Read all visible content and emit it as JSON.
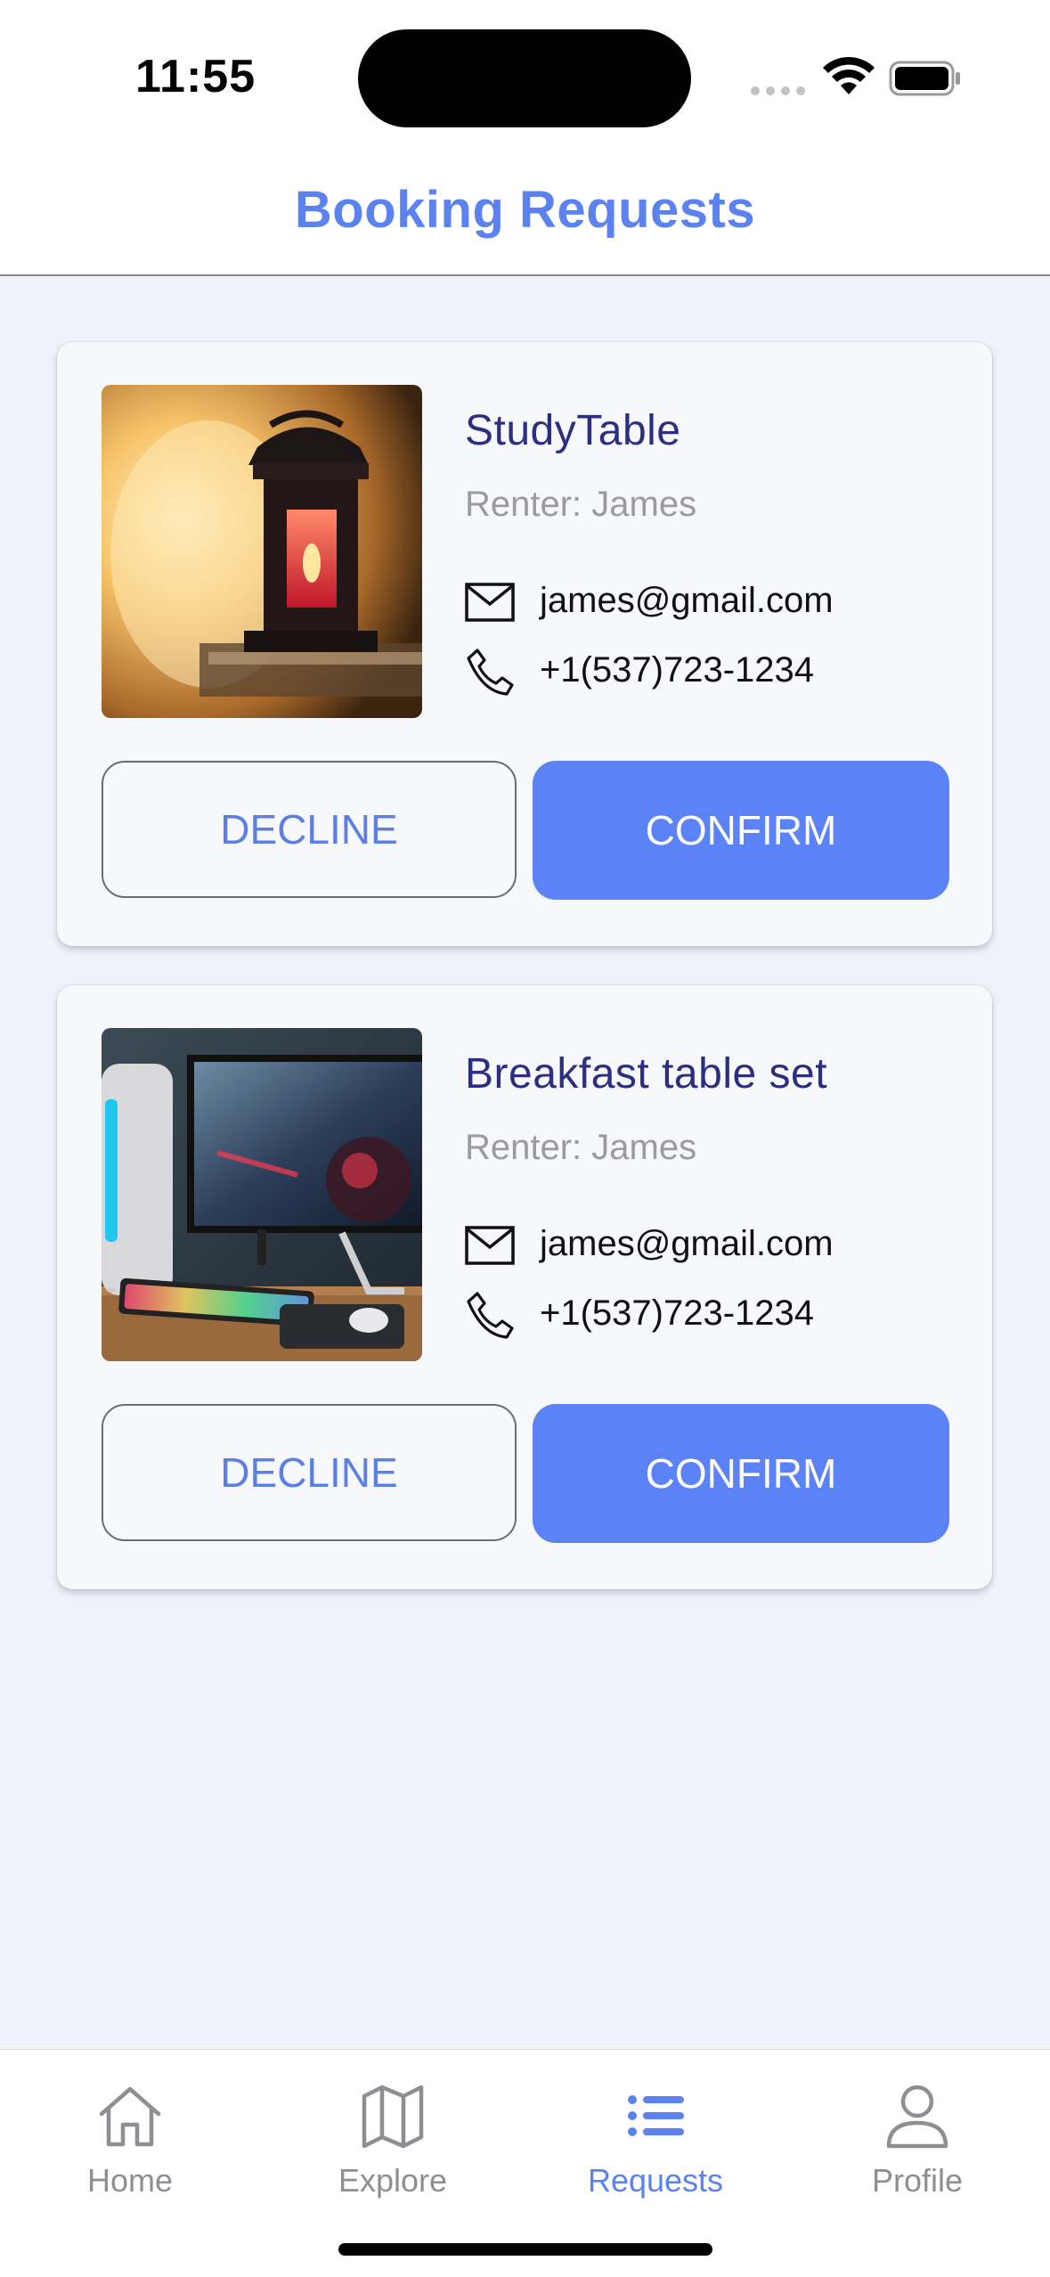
{
  "status_bar": {
    "time": "11:55"
  },
  "header": {
    "title": "Booking Requests"
  },
  "requests": [
    {
      "item_name": "StudyTable",
      "renter": "Renter: James",
      "email": "james@gmail.com",
      "phone": "+1(537)723-1234",
      "image": "lantern-photo",
      "decline_label": "DECLINE",
      "confirm_label": "CONFIRM"
    },
    {
      "item_name": "Breakfast table set",
      "renter": "Renter: James",
      "email": "james@gmail.com",
      "phone": "+1(537)723-1234",
      "image": "computer-desk-photo",
      "decline_label": "DECLINE",
      "confirm_label": "CONFIRM"
    }
  ],
  "tab_bar": {
    "tabs": [
      {
        "label": "Home",
        "icon": "home-icon"
      },
      {
        "label": "Explore",
        "icon": "map-icon"
      },
      {
        "label": "Requests",
        "icon": "list-icon",
        "active": true
      },
      {
        "label": "Profile",
        "icon": "person-icon"
      }
    ]
  },
  "colors": {
    "accent": "#5b82f6",
    "title_text": "#2c2f7f",
    "background": "#f0f2fb"
  }
}
